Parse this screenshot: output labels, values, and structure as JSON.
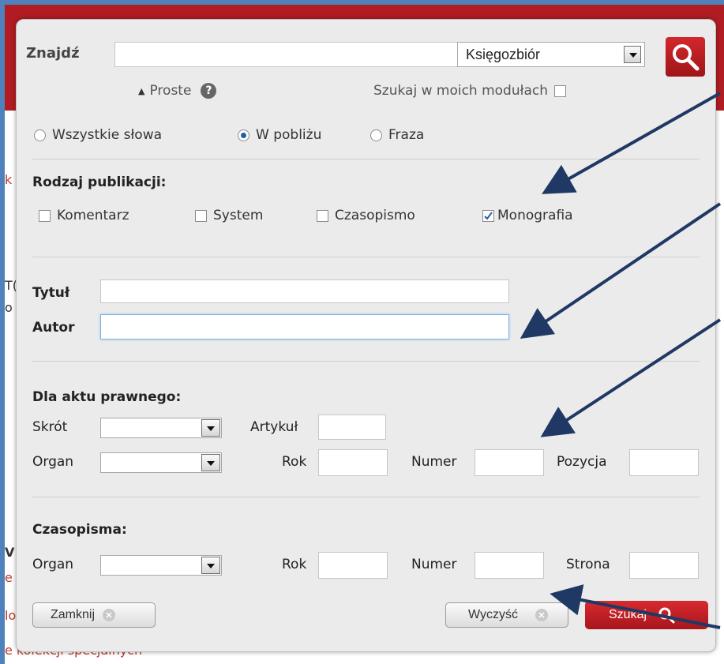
{
  "search": {
    "label": "Znajdź",
    "query": "",
    "scope_selected": "Księgozbiór",
    "simple_link": "Proste",
    "help_icon": "question-circle-icon",
    "my_modules_label": "Szukaj w moich modułach",
    "my_modules_checked": false
  },
  "match_mode": {
    "options": [
      "Wszystkie słowa",
      "W pobliżu",
      "Fraza"
    ],
    "selected": "W pobliżu"
  },
  "publication_type": {
    "heading": "Rodzaj publikacji:",
    "options": [
      {
        "label": "Komentarz",
        "checked": false
      },
      {
        "label": "System",
        "checked": false
      },
      {
        "label": "Czasopismo",
        "checked": false
      },
      {
        "label": "Monografia",
        "checked": true
      }
    ]
  },
  "fields": {
    "title_label": "Tytuł",
    "title_value": "",
    "author_label": "Autor",
    "author_value": ""
  },
  "legal_act": {
    "heading": "Dla aktu prawnego:",
    "abbrev_label": "Skrót",
    "article_label": "Artykuł",
    "organ_label": "Organ",
    "year_label": "Rok",
    "number_label": "Numer",
    "position_label": "Pozycja"
  },
  "journals": {
    "heading": "Czasopisma:",
    "organ_label": "Organ",
    "year_label": "Rok",
    "number_label": "Numer",
    "page_label": "Strona"
  },
  "buttons": {
    "close": "Zamknij",
    "clear": "Wyczyść",
    "search": "Szukaj"
  },
  "background": {
    "fragments": [
      "k",
      "T(",
      "o",
      "V",
      "e",
      "lo",
      "e kolekcji specjalnych"
    ]
  },
  "colors": {
    "accent_red": "#b01c22",
    "arrow": "#1f3864",
    "frame": "#4f81bd"
  }
}
